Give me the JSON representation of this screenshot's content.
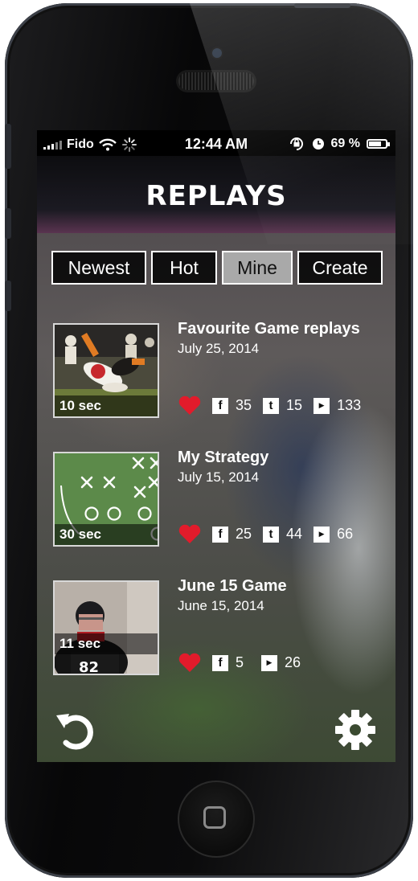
{
  "status_bar": {
    "carrier": "Fido",
    "time": "12:44 AM",
    "battery": "69 %"
  },
  "header": {
    "title": "REPLAYS"
  },
  "tabs": [
    {
      "label": "Newest"
    },
    {
      "label": "Hot"
    },
    {
      "label": "Mine"
    },
    {
      "label": "Create"
    }
  ],
  "active_tab": "Mine",
  "items": [
    {
      "title": "Favourite Game replays",
      "date": "July 25, 2014",
      "duration": "10 sec",
      "facebook": "35",
      "tumblr": "15",
      "youtube": "133"
    },
    {
      "title": "My Strategy",
      "date": "July 15, 2014",
      "duration": "30 sec",
      "facebook": "25",
      "tumblr": "44",
      "youtube": "66"
    },
    {
      "title": "June 15 Game",
      "date": "June 15, 2014",
      "duration": "11 sec",
      "facebook": "5",
      "youtube": "26"
    }
  ],
  "colors": {
    "heart": "#e21b2b",
    "active_tab_bg": "#a9a9a9",
    "tab_border": "#ffffff"
  },
  "icons": {
    "bottom_left": "undo-icon",
    "bottom_right": "gear-icon"
  }
}
